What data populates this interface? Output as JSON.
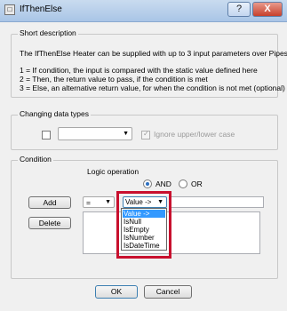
{
  "window": {
    "title": "IfThenElse",
    "help_glyph": "?",
    "close_glyph": "X",
    "app_icon_glyph": "□"
  },
  "short_description": {
    "title": "Short description",
    "lines": [
      "The IfThenElse Heater can be supplied with up to 3 input parameters over Pipes.",
      "1 = If condition, the input is compared with the static value defined here",
      "2 = Then, the return value to pass, if the condition is met",
      "3 = Else, an alternative return value, for when the condition is not met (optional)"
    ]
  },
  "changing_data_types": {
    "title": "Changing data types",
    "checkbox_checked": false,
    "combo_value": "",
    "combo_arrow": "▼",
    "ignore_case_label": "Ignore upper/lower case",
    "ignore_case_checked": true
  },
  "condition": {
    "title": "Condition",
    "logic_operation_label": "Logic operation",
    "and_label": "AND",
    "or_label": "OR",
    "and_selected": true,
    "add_button": "Add",
    "delete_button": "Delete",
    "operator_value": "=",
    "operator_arrow": "▼",
    "value_combo": "Value ->",
    "value_combo_arrow": "▼",
    "value_options": [
      "Value ->",
      "IsNull",
      "IsEmpty",
      "IsNumber",
      "IsDateTime"
    ],
    "selected_option_index": 0,
    "text_value": ""
  },
  "footer": {
    "ok_button": "OK",
    "cancel_button": "Cancel"
  },
  "colors": {
    "highlight": "#c8102e",
    "selection": "#3399ff",
    "title_bar": "#a9c5e6"
  }
}
